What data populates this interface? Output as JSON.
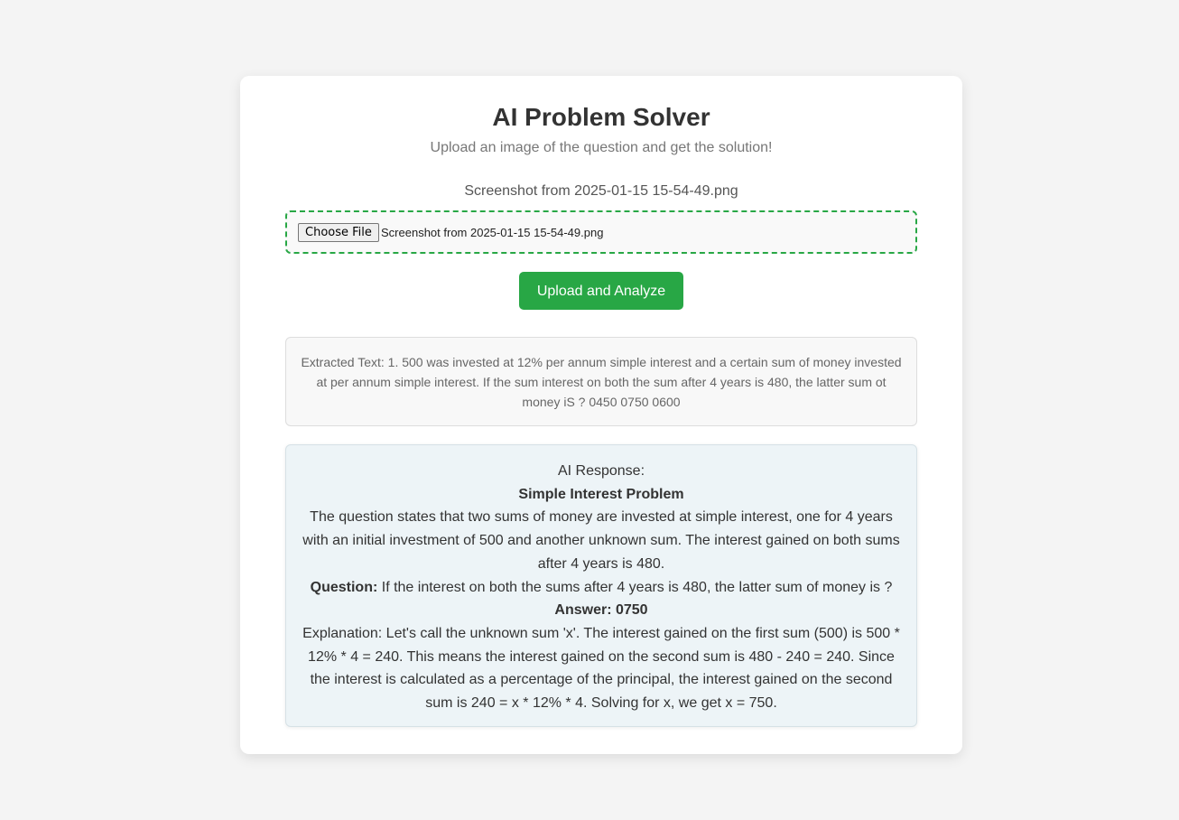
{
  "header": {
    "title": "AI Problem Solver",
    "subtitle": "Upload an image of the question and get the solution!"
  },
  "upload": {
    "selected_file_label": "Screenshot from 2025-01-15 15-54-49.png",
    "choose_button_label": "Choose File",
    "chosen_file_name": "Screenshot from 2025-01-15 15-54-49.png",
    "submit_label": "Upload and Analyze"
  },
  "extracted": {
    "text": "Extracted Text: 1. 500 was invested at 12% per annum simple interest and a certain sum of money invested at per annum simple interest. If the sum interest on both the sum after 4 years is 480, the latter sum ot money iS ? 0450 0750 0600"
  },
  "response": {
    "label": "AI Response:",
    "heading": "Simple Interest Problem",
    "summary": "The question states that two sums of money are invested at simple interest, one for 4 years with an initial investment of 500 and another unknown sum. The interest gained on both sums after 4 years is 480.",
    "question_label": "Question:",
    "question_text": " If the interest on both the sums after 4 years is 480, the latter sum of money is ?",
    "answer": "Answer: 0750",
    "explanation": "Explanation: Let's call the unknown sum 'x'. The interest gained on the first sum (500) is 500 * 12% * 4 = 240. This means the interest gained on the second sum is 480 - 240 = 240. Since the interest is calculated as a percentage of the principal, the interest gained on the second sum is 240 = x * 12% * 4. Solving for x, we get x = 750."
  },
  "colors": {
    "accent": "#28a745",
    "page_background": "#f4f4f4",
    "response_background": "#edf4f7"
  }
}
